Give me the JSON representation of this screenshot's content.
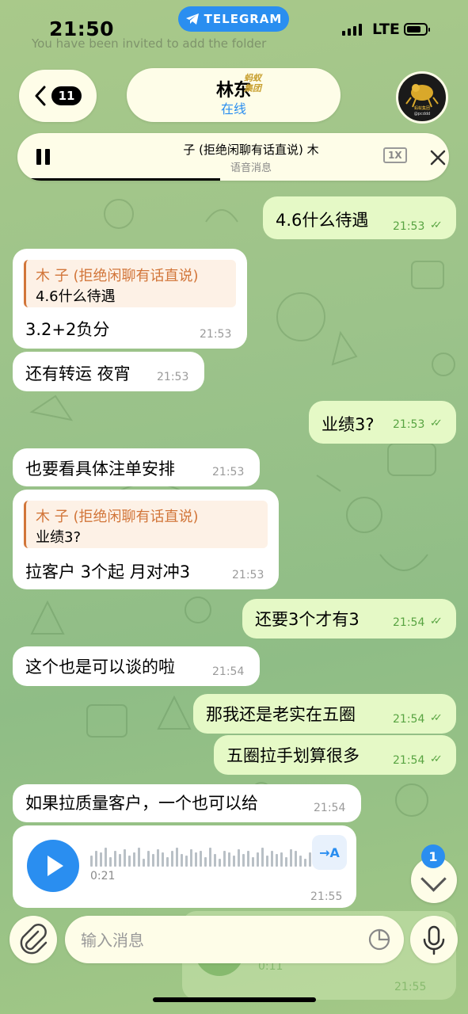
{
  "status_bar": {
    "time": "21:50",
    "app_pill": "TELEGRAM",
    "network": "LTE",
    "battery_level": 0.75
  },
  "header": {
    "back_count": "11",
    "name": "林东",
    "status": "在线",
    "logo_text": "蚂蚁集团",
    "avatar_caption": "@pcddd"
  },
  "voice_player": {
    "title": "子 (拒绝闲聊有话直说) 木",
    "subtitle": "语音消息",
    "speed": "1X",
    "progress": 0.47
  },
  "background_text": "You have been invited to add the folder",
  "messages": [
    {
      "dir": "out",
      "text": "4.6什么待遇",
      "time": "21:53"
    },
    {
      "dir": "in",
      "reply_name": "木 子 (拒绝闲聊有话直说)",
      "reply_text": "4.6什么待遇",
      "text": "3.2+2负分",
      "time": "21:53"
    },
    {
      "dir": "in",
      "text": "还有转运 夜宵",
      "time": "21:53"
    },
    {
      "dir": "out",
      "text": "业绩3?",
      "time": "21:53"
    },
    {
      "dir": "in",
      "text": "也要看具体注单安排",
      "time": "21:53"
    },
    {
      "dir": "in",
      "reply_name": "木 子 (拒绝闲聊有话直说)",
      "reply_text": "业绩3?",
      "text": "拉客户 3个起 月对冲3",
      "time": "21:53"
    },
    {
      "dir": "out",
      "text": "还要3个才有3",
      "time": "21:54"
    },
    {
      "dir": "in",
      "text": "这个也是可以谈的啦",
      "time": "21:54"
    },
    {
      "dir": "out",
      "text": "那我还是老实在五圈",
      "time": "21:54"
    },
    {
      "dir": "out",
      "text": "五圈拉手划算很多",
      "time": "21:54"
    },
    {
      "dir": "in",
      "text": "如果拉质量客户，一个也可以给",
      "time": "21:54"
    }
  ],
  "voice_message": {
    "duration": "0:21",
    "time": "21:55",
    "transcribe_label": "→A"
  },
  "faded_voice": {
    "duration": "0:11",
    "time": "21:55"
  },
  "scroll_down": {
    "unread_count": "1"
  },
  "input": {
    "placeholder": "输入消息"
  },
  "colors": {
    "accent": "#2a8ef0",
    "outgoing_bubble": "#e5f9c6",
    "incoming_bubble": "#ffffff",
    "reply_accent": "#d2763a",
    "read_ticks": "#58a442"
  }
}
